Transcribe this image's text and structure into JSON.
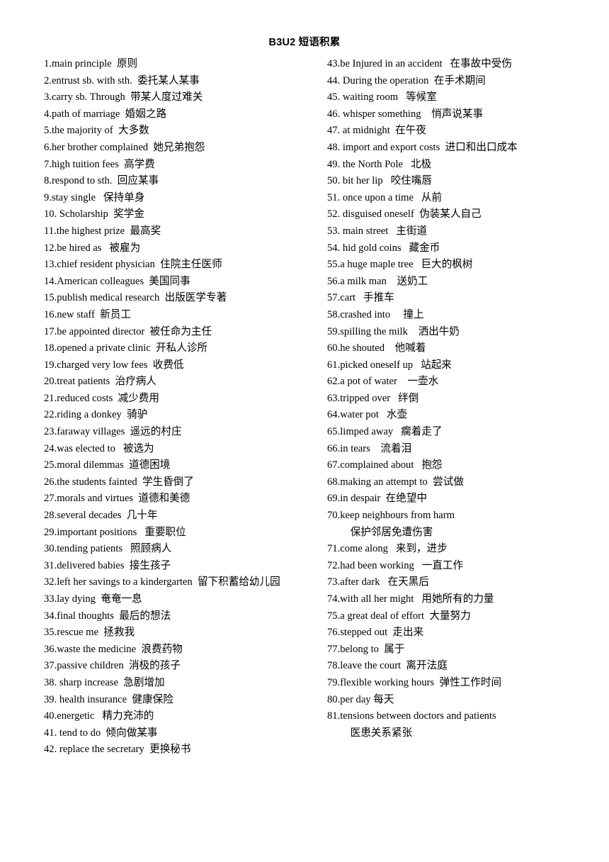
{
  "document": {
    "title": "B3U2 短语积累",
    "left_column": [
      "1.main principle  原则",
      "2.entrust sb. with sth.  委托某人某事",
      "3.carry sb. Through  带某人度过难关",
      "4.path of marriage  婚姻之路",
      "5.the majority of  大多数",
      "6.her brother complained  她兄弟抱怨",
      "7.high tuition fees  高学费",
      "8.respond to sth.  回应某事",
      "9.stay single   保持单身",
      "10. Scholarship  奖学金",
      "11.the highest prize  最高奖",
      "12.be hired as   被雇为",
      "13.chief resident physician  住院主任医师",
      "14.American colleagues  美国同事",
      "15.publish medical research  出版医学专著",
      "16.new staff  新员工",
      "17.be appointed director  被任命为主任",
      "18.opened a private clinic  开私人诊所",
      "19.charged very low fees  收费低",
      "20.treat patients  治疗病人",
      "21.reduced costs  减少费用",
      "22.riding a donkey  骑驴",
      "23.faraway villages  遥远的村庄",
      "24.was elected to   被选为",
      "25.moral dilemmas  道德困境",
      "26.the students fainted  学生昏倒了",
      "27.morals and virtues  道德和美德",
      "28.several decades  几十年",
      "29.important positions   重要职位",
      "30.tending patients   照顾病人",
      "31.delivered babies  接生孩子",
      "32.left her savings to a kindergarten  留下积蓄给幼儿园",
      "33.lay dying  奄奄一息",
      "34.final thoughts  最后的想法",
      "35.rescue me  拯救我",
      "36.waste the medicine  浪费药物",
      "37.passive children  消极的孩子",
      "38. sharp increase  急剧增加",
      "39. health insurance  健康保险",
      "40.energetic   精力充沛的",
      "41. tend to do  倾向做某事",
      "42. replace the secretary  更换秘书"
    ],
    "right_column": [
      "43.be Injured in an accident   在事故中受伤",
      "44. During the operation  在手术期间",
      "45. waiting room   等候室",
      "46. whisper something    悄声说某事",
      "47. at midnight  在午夜",
      "48. import and export costs  进口和出口成本",
      "49. the North Pole   北极",
      "50. bit her lip   咬住嘴唇",
      "51. once upon a time   从前",
      "52. disguised oneself  伪装某人自己",
      "53. main street   主街道",
      "54. hid gold coins   藏金币",
      "55.a huge maple tree   巨大的枫树",
      "56.a milk man    送奶工",
      "57.cart   手推车",
      "58.crashed into     撞上",
      "59.spilling the milk    洒出牛奶",
      "60.he shouted    他喊着",
      "61.picked oneself up   站起来",
      "62.a pot of water    一壶水",
      "63.tripped over   绊倒",
      "64.water pot   水壶",
      "65.limped away   瘸着走了",
      "66.in tears    流着泪",
      "67.complained about   抱怨",
      "68.making an attempt to  尝试做",
      "69.in despair  在绝望中",
      "70.keep neighbours from harm",
      "    保护邻居免遭伤害",
      "71.come along   来到，进步",
      "72.had been working   一直工作",
      "73.after dark   在天黑后",
      "74.with all her might   用她所有的力量",
      "75.a great deal of effort  大量努力",
      "76.stepped out  走出来",
      "77.belong to  属于",
      "78.leave the court  离开法庭",
      "79.flexible working hours  弹性工作时间",
      "80.per day 每天",
      "81.tensions between doctors and patients",
      "    医患关系紧张"
    ]
  }
}
